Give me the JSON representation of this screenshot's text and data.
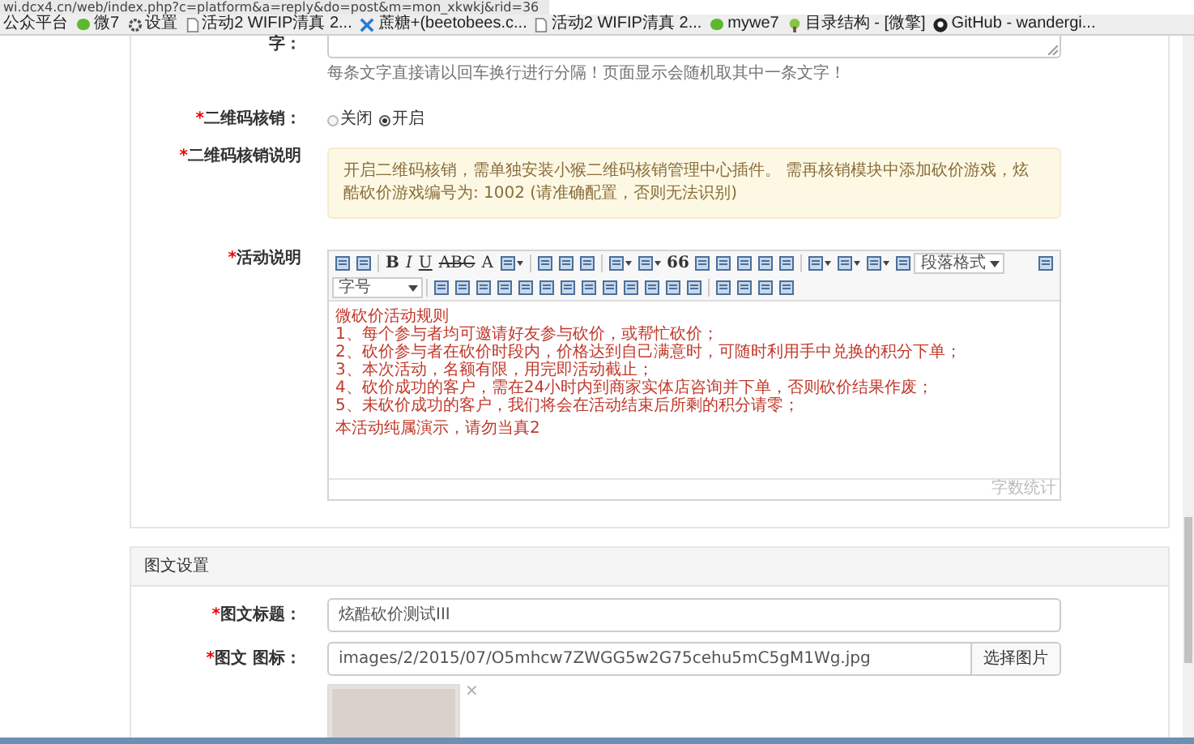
{
  "browser": {
    "url": "wi.dcx4.cn/web/index.php?c=platform&a=reply&do=post&m=mon_xkwkj&rid=36"
  },
  "bookmarks": [
    {
      "kind": "none",
      "label": "公众平台"
    },
    {
      "kind": "chat",
      "label": "微7"
    },
    {
      "kind": "gear",
      "label": "设置"
    },
    {
      "kind": "page",
      "label": "活动2 WIFIP清真 2..."
    },
    {
      "kind": "cross",
      "label": "蔗糖+(beetobees.c..."
    },
    {
      "kind": "page",
      "label": "活动2 WIFIP清真 2..."
    },
    {
      "kind": "chat",
      "label": "mywe7"
    },
    {
      "kind": "tree",
      "label": "目录结构 - [微擎]"
    },
    {
      "kind": "github",
      "label": "GitHub - wandergi..."
    }
  ],
  "top_field": {
    "label": "字：",
    "hint": "每条文字直接请以回车换行进行分隔！页面显示会随机取其中一条文字！"
  },
  "qr_verify": {
    "mark": "*",
    "label": "二维码核销：",
    "options": [
      {
        "label": "关闭",
        "selected": false
      },
      {
        "label": "开启",
        "selected": true
      }
    ]
  },
  "qr_note": {
    "mark": "*",
    "label": "二维码核销说明",
    "text": "开启二维码核销，需单独安装小猴二维码核销管理中心插件。 需再核销模块中添加砍价游戏，炫酷砍价游戏编号为: 1002 (请准确配置，否则无法识别)"
  },
  "activity": {
    "mark": "*",
    "label": "活动说明",
    "toolbar_rows": [
      [
        {
          "kind": "icon"
        },
        {
          "kind": "icon"
        },
        {
          "kind": "sep"
        },
        {
          "kind": "bold",
          "label": "B"
        },
        {
          "kind": "italic",
          "label": "I"
        },
        {
          "kind": "underline",
          "label": "U"
        },
        {
          "kind": "strike",
          "label": "ABC"
        },
        {
          "kind": "letter",
          "label": "A"
        },
        {
          "kind": "dropdown_icon"
        },
        {
          "kind": "sep"
        },
        {
          "kind": "icon"
        },
        {
          "kind": "icon"
        },
        {
          "kind": "icon"
        },
        {
          "kind": "sep"
        },
        {
          "kind": "dropdown_icon"
        },
        {
          "kind": "dropdown_icon"
        },
        {
          "kind": "bold",
          "label": "66"
        },
        {
          "kind": "icon"
        },
        {
          "kind": "icon"
        },
        {
          "kind": "icon"
        },
        {
          "kind": "icon"
        },
        {
          "kind": "icon"
        },
        {
          "kind": "sep"
        },
        {
          "kind": "dropdown_icon"
        },
        {
          "kind": "dropdown_icon"
        },
        {
          "kind": "dropdown_icon"
        },
        {
          "kind": "icon"
        },
        {
          "kind": "select",
          "label": "段落格式"
        },
        {
          "kind": "spacer"
        },
        {
          "kind": "icon"
        }
      ],
      [
        {
          "kind": "select",
          "label": "字号"
        },
        {
          "kind": "sep"
        },
        {
          "kind": "icon"
        },
        {
          "kind": "icon"
        },
        {
          "kind": "icon"
        },
        {
          "kind": "icon"
        },
        {
          "kind": "icon"
        },
        {
          "kind": "icon"
        },
        {
          "kind": "icon"
        },
        {
          "kind": "icon"
        },
        {
          "kind": "icon"
        },
        {
          "kind": "icon"
        },
        {
          "kind": "icon"
        },
        {
          "kind": "icon"
        },
        {
          "kind": "icon"
        },
        {
          "kind": "sep"
        },
        {
          "kind": "icon"
        },
        {
          "kind": "icon"
        },
        {
          "kind": "icon"
        },
        {
          "kind": "icon"
        }
      ]
    ],
    "content": [
      "微砍价活动规则",
      "1、每个参与者均可邀请好友参与砍价，或帮忙砍价；",
      "2、砍价参与者在砍价时段内，价格达到自己满意时，可随时利用手中兑换的积分下单；",
      "3、本次活动，名额有限，用完即活动截止；",
      "4、砍价成功的客户，需在24小时内到商家实体店咨询并下单，否则砍价结果作废；",
      "5、未砍价成功的客户，我们将会在活动结束后所剩的积分请零；",
      "本活动纯属演示，请勿当真2"
    ],
    "footer": "字数统计"
  },
  "news_section": {
    "title": "图文设置",
    "fields": [
      {
        "mark": "*",
        "label": "图文标题：",
        "value": "炫酷砍价测试III"
      },
      {
        "mark": "*",
        "label": "图文 图标：",
        "value": "images/2/2015/07/O5mhcw7ZWGG5w2G75cehu5mC5gM1Wg.jpg",
        "button": "选择图片"
      }
    ],
    "remove": "×"
  }
}
